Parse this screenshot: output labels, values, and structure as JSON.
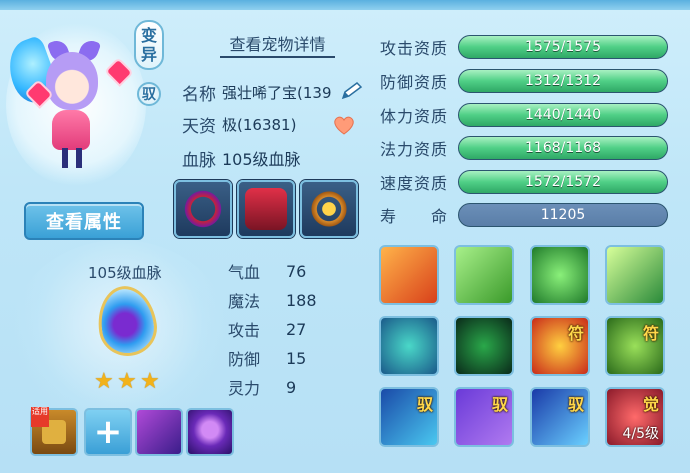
{
  "header": {},
  "pet": {
    "badge_variant": "变异",
    "badge_variant_top": "变",
    "badge_variant_bottom": "异",
    "badge_yu": "驭",
    "view_details": "查看宠物详情",
    "name_label": "名称",
    "name_value": "强壮唏了宝(139",
    "talent_label": "天资",
    "talent_value": "极(16381)",
    "bloodline_label": "血脉",
    "bloodline_value": "105级血脉",
    "view_attributes": "查看属性"
  },
  "bloodline_panel": {
    "title": "105级血脉",
    "stars": 3
  },
  "stats": [
    {
      "label": "气血",
      "value": "76"
    },
    {
      "label": "魔法",
      "value": "188"
    },
    {
      "label": "攻击",
      "value": "27"
    },
    {
      "label": "防御",
      "value": "15"
    },
    {
      "label": "灵力",
      "value": "9"
    }
  ],
  "aptitudes": [
    {
      "label": "攻击资质",
      "text": "1575/1575",
      "fill": 1.0
    },
    {
      "label": "防御资质",
      "text": "1312/1312",
      "fill": 1.0
    },
    {
      "label": "体力资质",
      "text": "1440/1440",
      "fill": 1.0
    },
    {
      "label": "法力资质",
      "text": "1168/1168",
      "fill": 1.0
    },
    {
      "label": "速度资质",
      "text": "1572/1572",
      "fill": 1.0
    }
  ],
  "life": {
    "label": "寿　　命",
    "value": "11205"
  },
  "equipment": [
    {
      "icon": "red-ring-icon"
    },
    {
      "icon": "red-armor-icon"
    },
    {
      "icon": "gold-necklace-icon"
    }
  ],
  "bottom_skills": [
    {
      "icon": "scroll-icon",
      "tag": "适用"
    },
    {
      "icon": "add-icon"
    },
    {
      "icon": "purple-dash-icon"
    },
    {
      "icon": "purple-ghost-icon"
    }
  ],
  "skills": [
    {
      "icon": "flame-sword-icon",
      "mark": "",
      "level": ""
    },
    {
      "icon": "broad-sword-icon",
      "mark": "",
      "level": ""
    },
    {
      "icon": "green-warrior-icon",
      "mark": "",
      "level": ""
    },
    {
      "icon": "green-dash-icon",
      "mark": "",
      "level": ""
    },
    {
      "icon": "blue-figure-icon",
      "mark": "",
      "level": ""
    },
    {
      "icon": "shadow-warrior-icon",
      "mark": "",
      "level": ""
    },
    {
      "icon": "fire-charm-icon",
      "mark": "符",
      "level": ""
    },
    {
      "icon": "green-beast-icon",
      "mark": "符",
      "level": ""
    },
    {
      "icon": "blue-lamp-icon",
      "mark": "驭",
      "level": ""
    },
    {
      "icon": "purple-fist-icon",
      "mark": "驭",
      "level": ""
    },
    {
      "icon": "blue-runner-icon",
      "mark": "驭",
      "level": ""
    },
    {
      "icon": "red-awaken-icon",
      "mark": "觉",
      "level": "4/5级"
    }
  ],
  "colors": {
    "accent": "#3aa0d6",
    "bar_fill": "#4fcf86",
    "life_bar": "#5a7ea8"
  }
}
